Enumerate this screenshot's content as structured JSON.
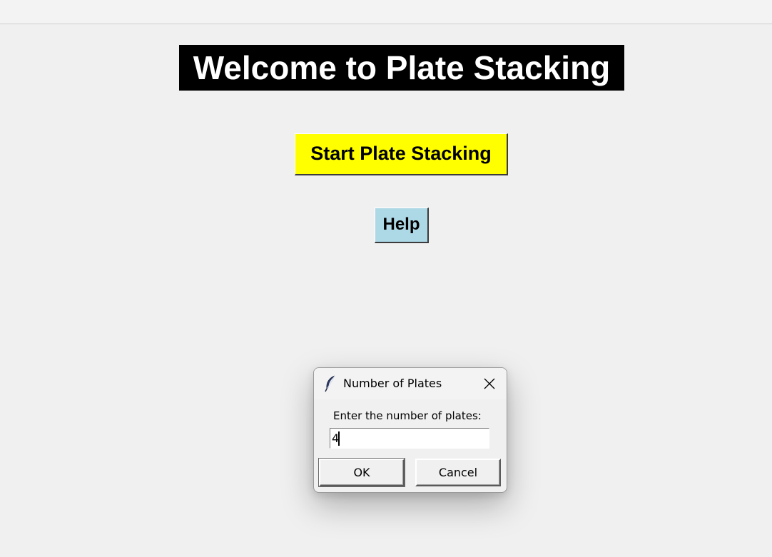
{
  "main_window": {
    "welcome_text": "Welcome to Plate Stacking",
    "start_button_label": "Start Plate Stacking",
    "help_button_label": "Help",
    "colors": {
      "welcome_bg": "#000000",
      "welcome_fg": "#ffffff",
      "start_button_bg": "#ffff00",
      "help_button_bg": "#add8e6"
    }
  },
  "dialog": {
    "title": "Number of Plates",
    "title_icon": "feather-icon",
    "close_icon": "close-icon",
    "prompt": "Enter the number of plates:",
    "input_value": "4",
    "ok_label": "OK",
    "cancel_label": "Cancel"
  }
}
